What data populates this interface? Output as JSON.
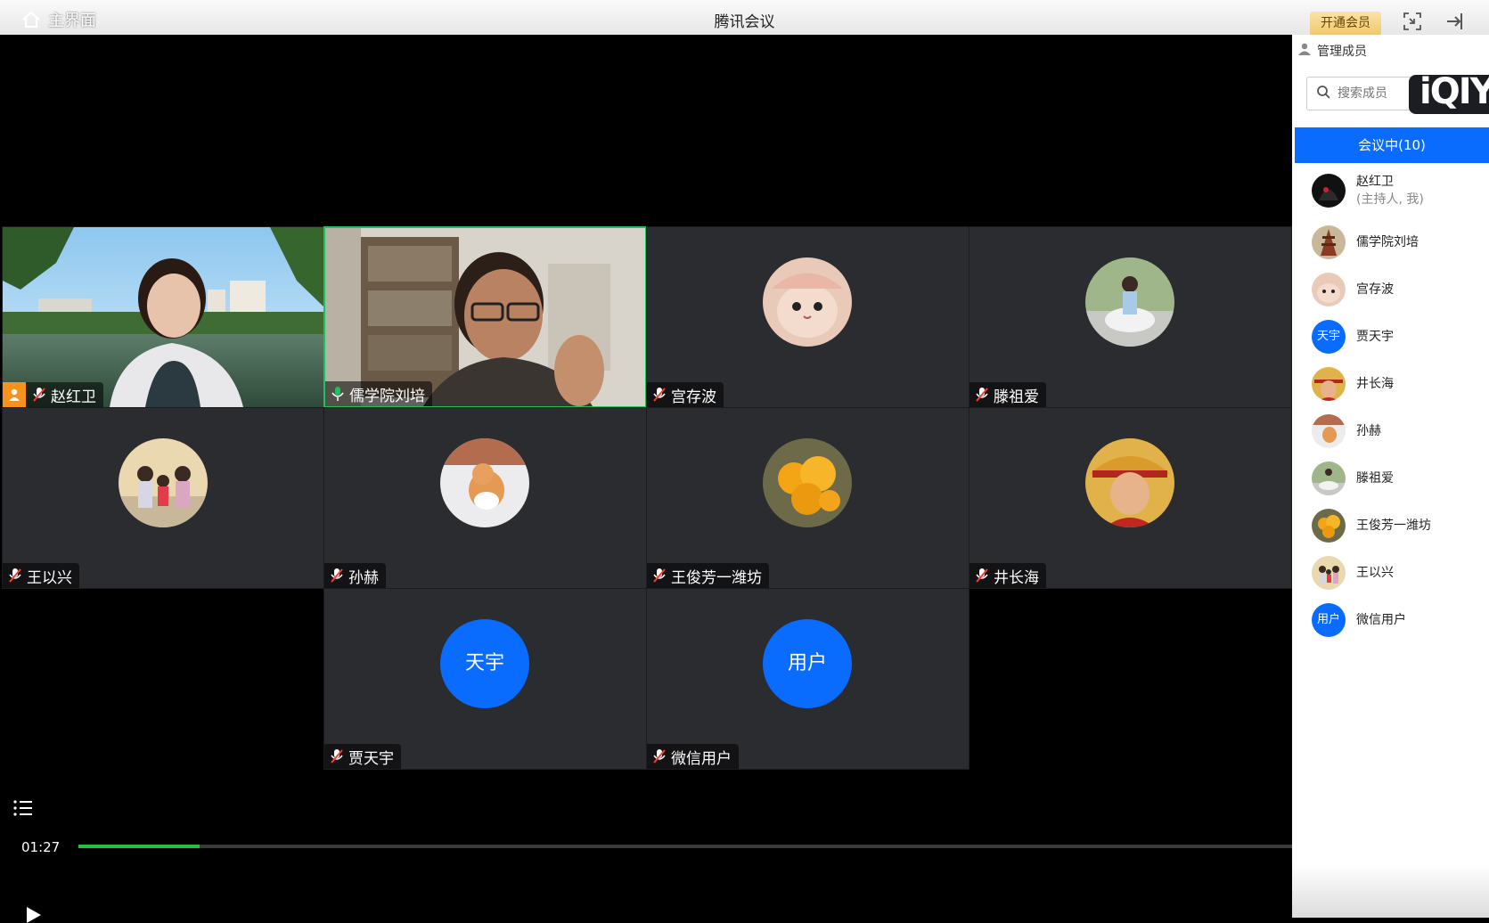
{
  "titlebar": {
    "home_label": "主界面",
    "app_title": "腾讯会议",
    "vip_label": "开通会员"
  },
  "tiles": [
    {
      "name": "赵红卫",
      "kind": "camera",
      "host": true,
      "mic": "muted"
    },
    {
      "name": "儒学院刘培",
      "kind": "camera",
      "host": false,
      "mic": "on"
    },
    {
      "name": "宫存波",
      "kind": "avatar",
      "mic": "muted"
    },
    {
      "name": "滕祖爱",
      "kind": "avatar",
      "mic": "muted"
    },
    {
      "name": "王以兴",
      "kind": "avatar",
      "mic": "muted"
    },
    {
      "name": "孙赫",
      "kind": "avatar",
      "mic": "muted"
    },
    {
      "name": "王俊芳一潍坊",
      "kind": "avatar",
      "mic": "muted"
    },
    {
      "name": "井长海",
      "kind": "avatar",
      "mic": "muted"
    },
    {
      "name": "贾天宇",
      "kind": "text",
      "avatar_text": "天宇",
      "mic": "muted"
    },
    {
      "name": "微信用户",
      "kind": "text",
      "avatar_text": "用户",
      "mic": "muted"
    }
  ],
  "player": {
    "time": "01:27",
    "progress": 0.1
  },
  "panel": {
    "header": "管理成员",
    "search_placeholder": "搜索成员",
    "watermark": "iQIY",
    "tab_label": "会议中(10)",
    "members": [
      {
        "name": "赵红卫",
        "sub": "(主持人, 我)"
      },
      {
        "name": "儒学院刘培"
      },
      {
        "name": "宫存波"
      },
      {
        "name": "贾天宇",
        "avatar_text": "天宇"
      },
      {
        "name": "井长海"
      },
      {
        "name": "孙赫"
      },
      {
        "name": "滕祖爱"
      },
      {
        "name": "王俊芳一潍坊"
      },
      {
        "name": "王以兴"
      },
      {
        "name": "微信用户",
        "avatar_text": "用户"
      }
    ]
  },
  "colors": {
    "accent": "#0a6cff",
    "active_speaker": "#20c060",
    "progress": "#1ec23f",
    "host_badge": "#f7921e",
    "tile_bg": "#2a2c2f"
  }
}
